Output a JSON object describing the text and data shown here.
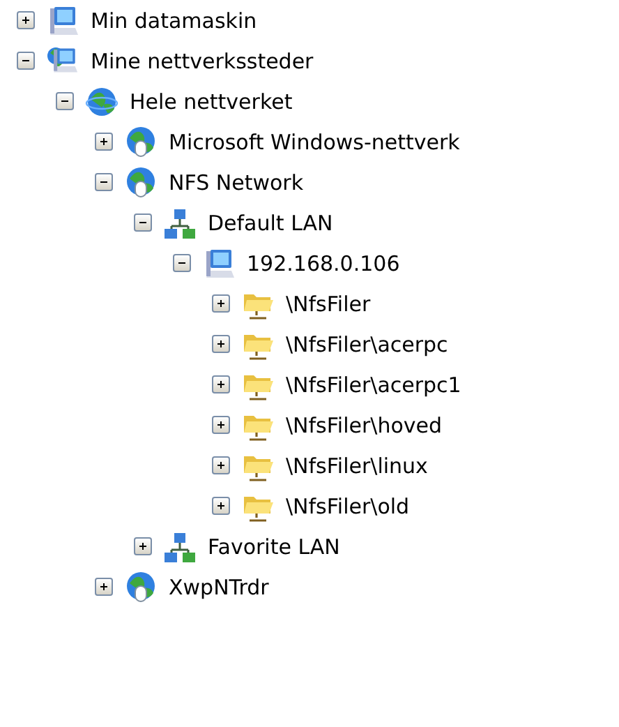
{
  "nodes": [
    {
      "label": "Min datamaskin",
      "kind": "computer",
      "expanded": false
    },
    {
      "label": "Mine nettverkssteder",
      "kind": "network-places",
      "expanded": true,
      "children": [
        {
          "label": "Hele nettverket",
          "kind": "globe",
          "expanded": true,
          "children": [
            {
              "label": "Microsoft Windows-nettverk",
              "kind": "network",
              "expanded": false
            },
            {
              "label": "NFS Network",
              "kind": "network",
              "expanded": true,
              "children": [
                {
                  "label": "Default LAN",
                  "kind": "lan",
                  "expanded": true,
                  "children": [
                    {
                      "label": "192.168.0.106",
                      "kind": "computer",
                      "expanded": true,
                      "children": [
                        {
                          "label": "\\NfsFiler",
                          "kind": "share",
                          "expanded": false
                        },
                        {
                          "label": "\\NfsFiler\\acerpc",
                          "kind": "share",
                          "expanded": false
                        },
                        {
                          "label": "\\NfsFiler\\acerpc1",
                          "kind": "share",
                          "expanded": false
                        },
                        {
                          "label": "\\NfsFiler\\hoved",
                          "kind": "share",
                          "expanded": false
                        },
                        {
                          "label": "\\NfsFiler\\linux",
                          "kind": "share",
                          "expanded": false
                        },
                        {
                          "label": "\\NfsFiler\\old",
                          "kind": "share",
                          "expanded": false
                        }
                      ]
                    }
                  ]
                },
                {
                  "label": "Favorite LAN",
                  "kind": "lan",
                  "expanded": false
                }
              ]
            },
            {
              "label": "XwpNTrdr",
              "kind": "network",
              "expanded": false
            }
          ]
        }
      ]
    }
  ]
}
